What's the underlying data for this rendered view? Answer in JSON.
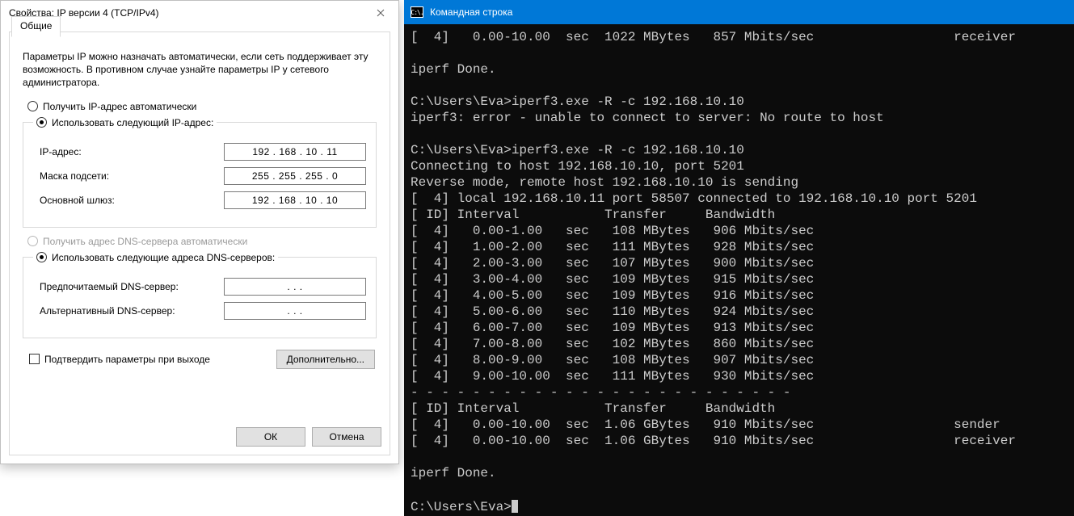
{
  "dialog": {
    "title": "Свойства: IP версии 4 (TCP/IPv4)",
    "tab": "Общие",
    "description": "Параметры IP можно назначать автоматически, если сеть поддерживает эту возможность. В противном случае узнайте параметры IP у сетевого администратора.",
    "radio_auto_ip": "Получить IP-адрес автоматически",
    "radio_manual_ip": "Использовать следующий IP-адрес:",
    "ip_label": "IP-адрес:",
    "ip_value": "192 . 168 .  10  .  11",
    "mask_label": "Маска подсети:",
    "mask_value": "255 . 255 . 255 .   0",
    "gw_label": "Основной шлюз:",
    "gw_value": "192 . 168 .  10  .  10",
    "radio_auto_dns": "Получить адрес DNS-сервера автоматически",
    "radio_manual_dns": "Использовать следующие адреса DNS-серверов:",
    "dns1_label": "Предпочитаемый DNS-сервер:",
    "dns1_value": ".        .        .",
    "dns2_label": "Альтернативный DNS-сервер:",
    "dns2_value": ".        .        .",
    "confirm_label": "Подтвердить параметры при выходе",
    "advanced": "Дополнительно...",
    "ok": "ОК",
    "cancel": "Отмена"
  },
  "cmd": {
    "title": "Командная строка",
    "icon": "C:\\.",
    "lines": [
      "[  4]   0.00-10.00  sec  1022 MBytes   857 Mbits/sec                  receiver",
      "",
      "iperf Done.",
      "",
      "C:\\Users\\Eva>iperf3.exe -R -c 192.168.10.10",
      "iperf3: error - unable to connect to server: No route to host",
      "",
      "C:\\Users\\Eva>iperf3.exe -R -c 192.168.10.10",
      "Connecting to host 192.168.10.10, port 5201",
      "Reverse mode, remote host 192.168.10.10 is sending",
      "[  4] local 192.168.10.11 port 58507 connected to 192.168.10.10 port 5201",
      "[ ID] Interval           Transfer     Bandwidth",
      "[  4]   0.00-1.00   sec   108 MBytes   906 Mbits/sec",
      "[  4]   1.00-2.00   sec   111 MBytes   928 Mbits/sec",
      "[  4]   2.00-3.00   sec   107 MBytes   900 Mbits/sec",
      "[  4]   3.00-4.00   sec   109 MBytes   915 Mbits/sec",
      "[  4]   4.00-5.00   sec   109 MBytes   916 Mbits/sec",
      "[  4]   5.00-6.00   sec   110 MBytes   924 Mbits/sec",
      "[  4]   6.00-7.00   sec   109 MBytes   913 Mbits/sec",
      "[  4]   7.00-8.00   sec   102 MBytes   860 Mbits/sec",
      "[  4]   8.00-9.00   sec   108 MBytes   907 Mbits/sec",
      "[  4]   9.00-10.00  sec   111 MBytes   930 Mbits/sec",
      "- - - - - - - - - - - - - - - - - - - - - - - - -",
      "[ ID] Interval           Transfer     Bandwidth",
      "[  4]   0.00-10.00  sec  1.06 GBytes   910 Mbits/sec                  sender",
      "[  4]   0.00-10.00  sec  1.06 GBytes   910 Mbits/sec                  receiver",
      "",
      "iperf Done.",
      "",
      "C:\\Users\\Eva>"
    ]
  }
}
